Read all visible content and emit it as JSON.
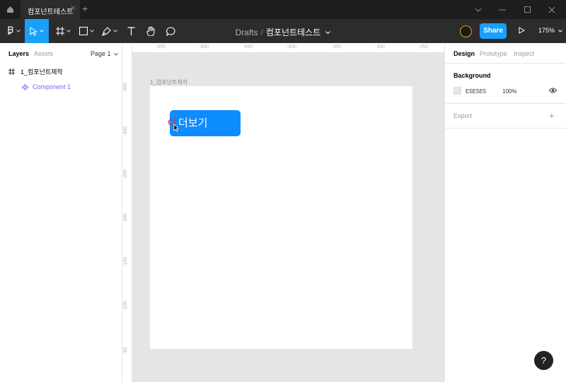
{
  "titlebar": {
    "tab_title": "컴포넌트테스트",
    "tab_close": "✕",
    "new_tab": "+",
    "window_controls": [
      "chevron-down",
      "minimize",
      "maximize",
      "close"
    ]
  },
  "toolbar": {
    "breadcrumb": {
      "folder": "Drafts",
      "separator": "/",
      "file": "컴포넌트테스트"
    },
    "tools": [
      "main-menu",
      "move",
      "frame",
      "shape",
      "pen",
      "text",
      "hand",
      "comment"
    ],
    "active_tool": "move",
    "share_label": "Share",
    "zoom_label": "175%"
  },
  "left_panel": {
    "tabs": [
      "Layers",
      "Assets"
    ],
    "active_tab": "Layers",
    "page_label": "Page 1",
    "layers": [
      {
        "label": "1_컴포넌트제작",
        "type": "frame"
      },
      {
        "label": "Component 1",
        "type": "component"
      }
    ]
  },
  "canvas": {
    "ruler_x": [
      "-550",
      "-500",
      "-450",
      "-400",
      "-350",
      "-300",
      "-250"
    ],
    "ruler_y": [
      "-350",
      "-300",
      "-250",
      "-200",
      "-150",
      "-100",
      "-50"
    ],
    "frame_label": "1_컴포넌트제작",
    "button_text": "더보기",
    "colors": {
      "canvas_bg": "#e5e5e5",
      "button_bg": "#0d8cff",
      "accent": "#18a0fb"
    }
  },
  "right_panel": {
    "tabs": [
      "Design",
      "Prototype",
      "Inspect"
    ],
    "active_tab": "Design",
    "background": {
      "title": "Background",
      "hex": "E5E5E5",
      "opacity": "100%"
    },
    "export": {
      "title": "Export",
      "add": "+"
    }
  },
  "help_label": "?"
}
